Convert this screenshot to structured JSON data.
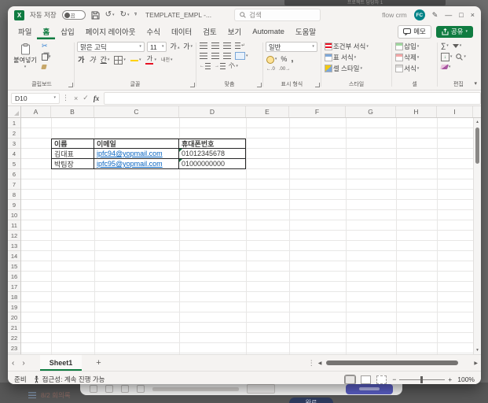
{
  "background": {
    "top_right_text": "프로젝트 담당자 1",
    "bottom_left_text": "8/2 회의록",
    "done_button_label": "완료"
  },
  "title_bar": {
    "app_initial": "X",
    "autosave_label": "자동 저장",
    "autosave_state": "끔",
    "title": "TEMPLATE_EMPL  -...",
    "search_placeholder": "검색",
    "account_name": "flow crm",
    "avatar_initials": "FC"
  },
  "icons": {
    "caret": "▾",
    "undo": "↺",
    "redo": "↻",
    "pencil": "✎",
    "minimize": "—",
    "maximize": "□",
    "close": "×",
    "cut": "✂",
    "dots": "⋮",
    "cancel": "×",
    "enter": "✓",
    "wrap": "↵",
    "left_arrow": "←",
    "right_arrow": "→",
    "prev": "‹",
    "next": "›",
    "scroll_left": "◀",
    "scroll_right": "▶",
    "scroll_up": "▴",
    "scroll_down": "▾",
    "minus": "−",
    "plus": "+",
    "down_arrow": "↓"
  },
  "ribbon_tabs": {
    "active_index": 1,
    "items": [
      {
        "id": "file",
        "label": "파일"
      },
      {
        "id": "home",
        "label": "홈"
      },
      {
        "id": "insert",
        "label": "삽입"
      },
      {
        "id": "page-layout",
        "label": "페이지 레이아웃"
      },
      {
        "id": "formulas",
        "label": "수식"
      },
      {
        "id": "data",
        "label": "데이터"
      },
      {
        "id": "review",
        "label": "검토"
      },
      {
        "id": "view",
        "label": "보기"
      },
      {
        "id": "automate",
        "label": "Automate"
      },
      {
        "id": "help",
        "label": "도움말"
      }
    ]
  },
  "ribbon_actions": {
    "comments_label": "메모",
    "share_label": "공유"
  },
  "ribbon": {
    "clipboard": {
      "group_label": "클립보드",
      "paste_label": "붙여넣기"
    },
    "font": {
      "group_label": "글꼴",
      "family": "맑은 고딕",
      "size": "11",
      "bold": "가",
      "italic": "가",
      "underline": "간",
      "grow": "가",
      "shrink": "가",
      "phonetic": "내천"
    },
    "alignment": {
      "group_label": "맞춤"
    },
    "number": {
      "group_label": "표시 형식",
      "format": "일반",
      "percent": "%",
      "comma": ",",
      "inc_decimal": "←.0",
      "dec_decimal": ".00→"
    },
    "styles": {
      "group_label": "스타일",
      "conditional": "조건부 서식",
      "table": "표 서식",
      "cell": "셀 스타일"
    },
    "cells": {
      "group_label": "셀",
      "insert": "삽입",
      "delete": "삭제",
      "format": "서식"
    },
    "editing": {
      "group_label": "편집",
      "autosum": "∑"
    }
  },
  "formula_bar": {
    "name_box": "D10",
    "fx_label": "fx",
    "value": ""
  },
  "spreadsheet": {
    "column_labels": [
      "A",
      "B",
      "C",
      "D",
      "E",
      "F",
      "G",
      "H",
      "I"
    ],
    "row_count": 23,
    "table": {
      "origin": "B3",
      "headers": [
        "이름",
        "이메일",
        "휴대폰번호"
      ],
      "rows": [
        {
          "name": "김대표",
          "email": "ipfc94@yopmail.com",
          "phone": "01012345678"
        },
        {
          "name": "박팀장",
          "email": "ipfc95@yopmail.com",
          "phone": "01000000000"
        }
      ]
    }
  },
  "sheet_bar": {
    "tabs": [
      {
        "name": "Sheet1",
        "active": true
      }
    ],
    "add_label": "+"
  },
  "status_bar": {
    "ready": "준비",
    "accessibility": "접근성: 계속 진행 가능",
    "zoom_level": "100%"
  }
}
